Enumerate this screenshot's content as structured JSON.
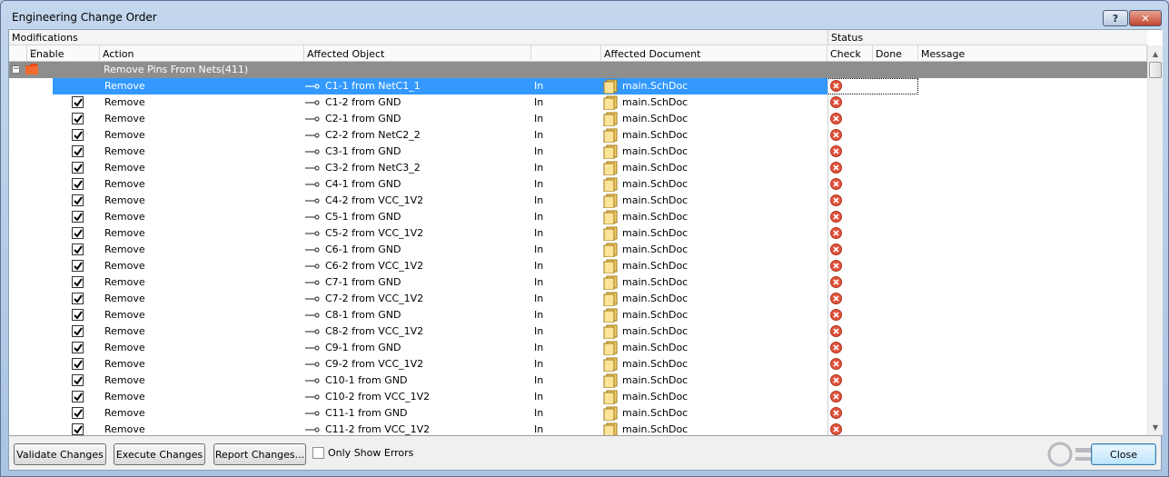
{
  "window": {
    "title": "Engineering Change Order",
    "help_label": "?",
    "close_glyph": "✕"
  },
  "grid": {
    "group_headers": {
      "modifications": "Modifications",
      "status": "Status"
    },
    "columns": {
      "enable": "Enable",
      "action": "Action",
      "affected_object": "Affected Object",
      "affected_document": "Affected Document",
      "check": "Check",
      "done": "Done",
      "message": "Message"
    },
    "group": {
      "label": "Remove Pins From Nets(411)",
      "expander": "−"
    },
    "rows": [
      {
        "action": "Remove",
        "object": "C1-1 from NetC1_1",
        "in": "In",
        "doc": "main.SchDoc"
      },
      {
        "action": "Remove",
        "object": "C1-2 from GND",
        "in": "In",
        "doc": "main.SchDoc"
      },
      {
        "action": "Remove",
        "object": "C2-1 from GND",
        "in": "In",
        "doc": "main.SchDoc"
      },
      {
        "action": "Remove",
        "object": "C2-2 from NetC2_2",
        "in": "In",
        "doc": "main.SchDoc"
      },
      {
        "action": "Remove",
        "object": "C3-1 from GND",
        "in": "In",
        "doc": "main.SchDoc"
      },
      {
        "action": "Remove",
        "object": "C3-2 from NetC3_2",
        "in": "In",
        "doc": "main.SchDoc"
      },
      {
        "action": "Remove",
        "object": "C4-1 from GND",
        "in": "In",
        "doc": "main.SchDoc"
      },
      {
        "action": "Remove",
        "object": "C4-2 from VCC_1V2",
        "in": "In",
        "doc": "main.SchDoc"
      },
      {
        "action": "Remove",
        "object": "C5-1 from GND",
        "in": "In",
        "doc": "main.SchDoc"
      },
      {
        "action": "Remove",
        "object": "C5-2 from VCC_1V2",
        "in": "In",
        "doc": "main.SchDoc"
      },
      {
        "action": "Remove",
        "object": "C6-1 from GND",
        "in": "In",
        "doc": "main.SchDoc"
      },
      {
        "action": "Remove",
        "object": "C6-2 from VCC_1V2",
        "in": "In",
        "doc": "main.SchDoc"
      },
      {
        "action": "Remove",
        "object": "C7-1 from GND",
        "in": "In",
        "doc": "main.SchDoc"
      },
      {
        "action": "Remove",
        "object": "C7-2 from VCC_1V2",
        "in": "In",
        "doc": "main.SchDoc"
      },
      {
        "action": "Remove",
        "object": "C8-1 from GND",
        "in": "In",
        "doc": "main.SchDoc"
      },
      {
        "action": "Remove",
        "object": "C8-2 from VCC_1V2",
        "in": "In",
        "doc": "main.SchDoc"
      },
      {
        "action": "Remove",
        "object": "C9-1 from GND",
        "in": "In",
        "doc": "main.SchDoc"
      },
      {
        "action": "Remove",
        "object": "C9-2 from VCC_1V2",
        "in": "In",
        "doc": "main.SchDoc"
      },
      {
        "action": "Remove",
        "object": "C10-1 from GND",
        "in": "In",
        "doc": "main.SchDoc"
      },
      {
        "action": "Remove",
        "object": "C10-2 from VCC_1V2",
        "in": "In",
        "doc": "main.SchDoc"
      },
      {
        "action": "Remove",
        "object": "C11-1 from GND",
        "in": "In",
        "doc": "main.SchDoc"
      },
      {
        "action": "Remove",
        "object": "C11-2 from VCC_1V2",
        "in": "In",
        "doc": "main.SchDoc"
      }
    ]
  },
  "buttons": {
    "validate": "Validate Changes",
    "execute": "Execute Changes",
    "report": "Report Changes...",
    "only_errors": "Only Show Errors",
    "close": "Close"
  },
  "colors": {
    "selection": "#3399ff",
    "error": "#e0533c",
    "group_row": "#8e8e8e"
  }
}
